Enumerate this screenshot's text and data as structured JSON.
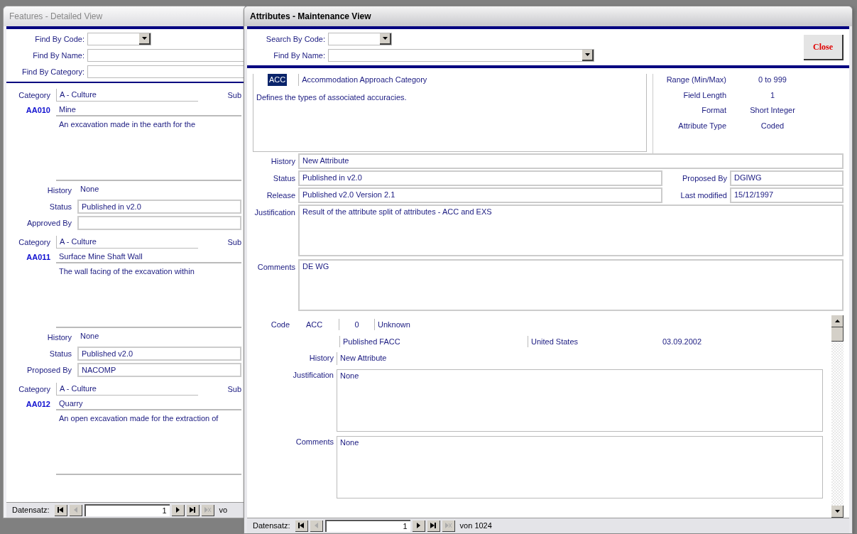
{
  "left_window": {
    "title": "Features - Detailed View",
    "filters": [
      {
        "label": "Find By Code:",
        "kind": "dropdown"
      },
      {
        "label": "Find By Name:",
        "kind": "text"
      },
      {
        "label": "Find By Category:",
        "kind": "text"
      }
    ],
    "records": [
      {
        "category_label": "Category",
        "category": "A - Culture",
        "sub_label": "Sub",
        "code": "AA010",
        "name": "Mine",
        "description": "An excavation made in the earth for the",
        "fields": [
          {
            "label": "History",
            "value": "None",
            "kind": "plain"
          },
          {
            "label": "Status",
            "value": "Published in v2.0",
            "kind": "boxed"
          },
          {
            "label": "Approved By",
            "kind": "boxed"
          }
        ]
      },
      {
        "category_label": "Category",
        "category": "A - Culture",
        "sub_label": "Sub",
        "code": "AA011",
        "name": "Surface Mine Shaft Wall",
        "description": "The wall facing of the excavation within",
        "fields": [
          {
            "label": "History",
            "value": "None",
            "kind": "plain"
          },
          {
            "label": "Status",
            "value": "Published v2.0",
            "kind": "boxed"
          },
          {
            "label": "Proposed By",
            "value": "NACOMP",
            "kind": "boxed"
          }
        ]
      },
      {
        "category_label": "Category",
        "category": "A - Culture",
        "sub_label": "Sub",
        "code": "AA012",
        "name": "Quarry",
        "description": "An open excavation made for the extraction of"
      }
    ],
    "nav": {
      "label": "Datensatz:",
      "record": "1",
      "suffix": "vo"
    }
  },
  "right_window": {
    "title": "Attributes - Maintenance View",
    "filters": [
      {
        "label": "Search By Code:",
        "kind": "dropdown"
      },
      {
        "label": "Find By Name:",
        "kind": "dropdown"
      }
    ],
    "close": "Close",
    "attribute": {
      "code": "ACC",
      "name": "Accommodation Approach Category",
      "description": "Defines the types of associated accuracies.",
      "properties": [
        {
          "label": "Range (Min/Max)",
          "value": "0 to 999"
        },
        {
          "label": "Field Length",
          "value": "1"
        },
        {
          "label": "Format",
          "value": "Short Integer"
        },
        {
          "label": "Attribute Type",
          "value": "Coded"
        }
      ]
    },
    "rows": [
      {
        "kind": "line",
        "fields": [
          {
            "label": "History",
            "value": "New Attribute"
          }
        ]
      },
      {
        "kind": "line",
        "fields": [
          {
            "label": "Status",
            "value": "Published in v2.0"
          },
          {
            "label": "Proposed By",
            "value": "DGIWG"
          }
        ]
      },
      {
        "kind": "line",
        "fields": [
          {
            "label": "Release",
            "value": "Published v2.0 Version 2.1"
          },
          {
            "label": "Last modified",
            "value": "15/12/1997"
          }
        ]
      },
      {
        "kind": "tall",
        "fields": [
          {
            "label": "Justification",
            "value": "Result of the attribute split of attributes - ACC and EXS"
          }
        ]
      },
      {
        "kind": "tall",
        "fields": [
          {
            "label": "Comments",
            "value": "DE WG"
          }
        ]
      }
    ],
    "values": {
      "code_label": "Code",
      "code": "ACC",
      "value": "0",
      "meaning": "Unknown",
      "status": "Published FACC",
      "country": "United States",
      "date": "03.09.2002",
      "fields": [
        {
          "label": "History",
          "value": "New Attribute",
          "kind": "plain"
        },
        {
          "label": "Justification",
          "value": "None",
          "kind": "box"
        },
        {
          "label": "Comments",
          "value": "None",
          "kind": "box"
        }
      ]
    },
    "nav": {
      "label": "Datensatz:",
      "record": "1",
      "suffix": "von 1024"
    }
  }
}
